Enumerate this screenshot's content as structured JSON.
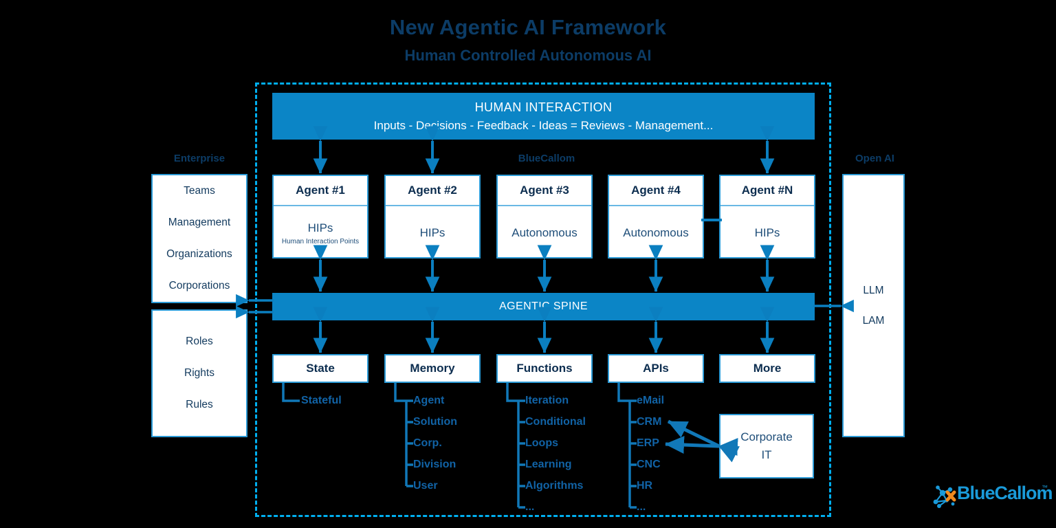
{
  "header": {
    "title": "New Agentic AI Framework",
    "subtitle": "Human Controlled Autonomous AI"
  },
  "captions": {
    "enterprise": "Enterprise",
    "bluecallom": "BlueCallom",
    "openai": "Open AI"
  },
  "human_interaction": {
    "title": "HUMAN INTERACTION",
    "subtitle": "Inputs - Decisions - Feedback - Ideas = Reviews - Management..."
  },
  "spine": {
    "label": "AGENTIC SPINE"
  },
  "enterprise_panel": {
    "items": [
      "Teams",
      "Management",
      "Organizations",
      "Corporations"
    ]
  },
  "rules_panel": {
    "items": [
      "Roles",
      "Rights",
      "Rules"
    ]
  },
  "openai_panel": {
    "items": [
      "LLM",
      "LAM"
    ]
  },
  "agents": [
    {
      "name": "Agent #1",
      "mode": "HIPs",
      "sub": "Human Interaction Points"
    },
    {
      "name": "Agent #2",
      "mode": "HIPs",
      "sub": ""
    },
    {
      "name": "Agent #3",
      "mode": "Autonomous",
      "sub": ""
    },
    {
      "name": "Agent #4",
      "mode": "Autonomous",
      "sub": ""
    },
    {
      "name": "Agent #N",
      "mode": "HIPs",
      "sub": ""
    }
  ],
  "capabilities": [
    {
      "title": "State",
      "items": [
        "Stateful"
      ]
    },
    {
      "title": "Memory",
      "items": [
        "Agent",
        "Solution",
        "Corp.",
        "Division",
        "User"
      ]
    },
    {
      "title": "Functions",
      "items": [
        "Iteration",
        "Conditional",
        "Loops",
        "Learning",
        "Algorithms",
        "..."
      ]
    },
    {
      "title": "APIs",
      "items": [
        "eMail",
        "CRM",
        "ERP",
        "CNC",
        "HR",
        "..."
      ]
    },
    {
      "title": "More",
      "items": []
    }
  ],
  "corporate_it": {
    "line1": "Corporate",
    "line2": "IT"
  },
  "logo": {
    "text": "BlueCallom",
    "tm": "™"
  },
  "colors": {
    "background": "#000000",
    "title_navy": "#0c3c66",
    "banner_blue": "#0b85c6",
    "dashed_cyan": "#00aeef",
    "box_border": "#2b9ad6",
    "body_navy": "#1f4e79",
    "tree_blue": "#1163a6",
    "logo_blue": "#1a9ad9",
    "logo_orange": "#f08a1e"
  }
}
